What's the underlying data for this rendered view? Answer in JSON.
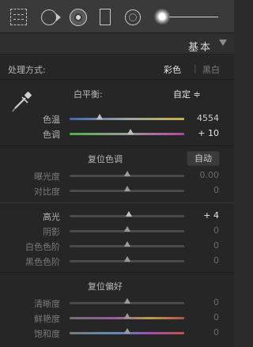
{
  "toolbar": {
    "tools": [
      {
        "icon": "crop-overlay-icon"
      },
      {
        "icon": "spot-removal-icon"
      },
      {
        "icon": "red-eye-icon"
      },
      {
        "icon": "graduated-filter-icon"
      },
      {
        "icon": "radial-filter-icon"
      },
      {
        "icon": "adjustment-brush-icon"
      }
    ]
  },
  "panel": {
    "title": "基本",
    "treatment_label": "处理方式:",
    "treatment_color": "彩色",
    "treatment_separator": "|",
    "treatment_bw": "黑白",
    "wb_label": "白平衡:",
    "wb_value": "自定 ≑",
    "tone_section_label": "复位色调",
    "auto_label": "自动",
    "presence_section_label": "复位偏好"
  },
  "sliders": {
    "temp": {
      "label": "色温",
      "value": "4554",
      "position": 0.26
    },
    "tint": {
      "label": "色调",
      "value": "+ 10",
      "position": 0.53
    },
    "exposure": {
      "label": "曝光度",
      "value": "0.00",
      "position": 0.5
    },
    "contrast": {
      "label": "对比度",
      "value": "0",
      "position": 0.5
    },
    "highlights": {
      "label": "高光",
      "value": "+ 4",
      "position": 0.52
    },
    "shadows": {
      "label": "阴影",
      "value": "0",
      "position": 0.5
    },
    "whites": {
      "label": "白色色阶",
      "value": "0",
      "position": 0.5
    },
    "blacks": {
      "label": "黑色色阶",
      "value": "0",
      "position": 0.5
    },
    "clarity": {
      "label": "清晰度",
      "value": "0",
      "position": 0.5
    },
    "vibrance": {
      "label": "鲜艳度",
      "value": "0",
      "position": 0.5
    },
    "saturation": {
      "label": "饱和度",
      "value": "0",
      "position": 0.5
    }
  },
  "colors": {
    "background": "#262626",
    "toolbar": "#3a3a3a",
    "text": "#b9b9b9",
    "highlight_text": "#e6e6e6"
  }
}
